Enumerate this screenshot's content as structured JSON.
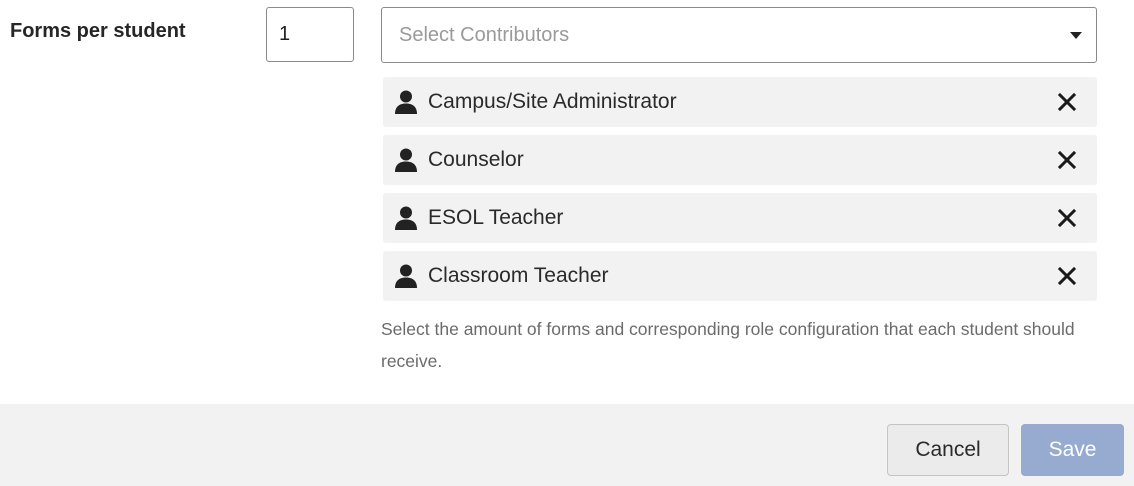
{
  "form": {
    "label": "Forms per student",
    "count_value": "1",
    "select_placeholder": "Select Contributors",
    "contributors": [
      {
        "label": "Campus/Site Administrator",
        "icon": "person-icon"
      },
      {
        "label": "Counselor",
        "icon": "person-icon"
      },
      {
        "label": "ESOL Teacher",
        "icon": "person-icon"
      },
      {
        "label": "Classroom Teacher",
        "icon": "person-icon"
      }
    ],
    "helper_text": "Select the amount of forms and corresponding role configuration that each student should receive."
  },
  "footer": {
    "cancel_label": "Cancel",
    "save_label": "Save"
  },
  "colors": {
    "save_button_bg": "#97aad0",
    "chip_bg": "#f2f2f2",
    "footer_bg": "#f2f2f2"
  }
}
